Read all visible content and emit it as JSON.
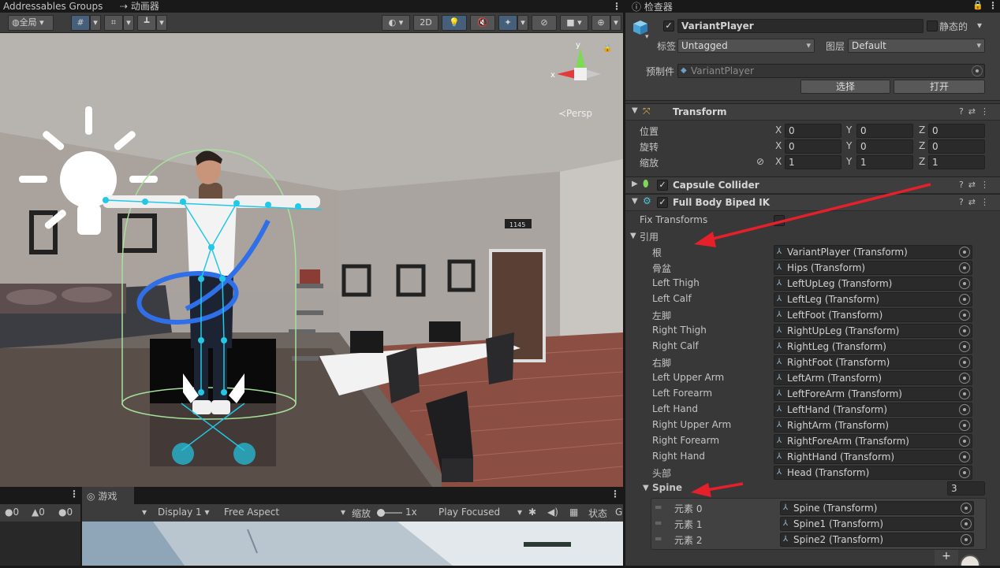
{
  "tabs": {
    "addressables": "Addressables Groups",
    "animator": "动画器",
    "inspector": "检查器"
  },
  "scene_toolbar": {
    "global": "全局",
    "mode_2d": "2D",
    "persp": "≺Persp"
  },
  "scene": {
    "wall_sign": "1145"
  },
  "bottom": {
    "counter_errors": "0",
    "counter_warnings": "0",
    "counter_messages": "0",
    "game_tab": "游戏",
    "display": "Display 1",
    "aspect": "Free Aspect",
    "scale_label": "缩放",
    "scale_value": "1x",
    "play_mode": "Play Focused",
    "stats": "状态",
    "gizmos": "Gi"
  },
  "object": {
    "name": "VariantPlayer",
    "static_label": "静态的",
    "tag_label": "标签",
    "tag_value": "Untagged",
    "layer_label": "图层",
    "layer_value": "Default",
    "prefab_label": "预制件",
    "prefab_value": "VariantPlayer",
    "select_btn": "选择",
    "open_btn": "打开"
  },
  "transform": {
    "title": "Transform",
    "position_label": "位置",
    "rotation_label": "旋转",
    "scale_label": "缩放",
    "axis_x": "X",
    "axis_y": "Y",
    "axis_z": "Z",
    "position": [
      "0",
      "0",
      "0"
    ],
    "rotation": [
      "0",
      "0",
      "0"
    ],
    "scale": [
      "1",
      "1",
      "1"
    ]
  },
  "capsule": {
    "title": "Capsule Collider"
  },
  "ik": {
    "title": "Full Body Biped IK",
    "fix_transforms": "Fix Transforms",
    "references": "引用",
    "refs": [
      {
        "label": "根",
        "value": "VariantPlayer (Transform)"
      },
      {
        "label": "骨盆",
        "value": "Hips (Transform)"
      },
      {
        "label": "Left Thigh",
        "value": "LeftUpLeg (Transform)"
      },
      {
        "label": "Left Calf",
        "value": "LeftLeg (Transform)"
      },
      {
        "label": "左脚",
        "value": "LeftFoot (Transform)"
      },
      {
        "label": "Right Thigh",
        "value": "RightUpLeg (Transform)"
      },
      {
        "label": "Right Calf",
        "value": "RightLeg (Transform)"
      },
      {
        "label": "右脚",
        "value": "RightFoot (Transform)"
      },
      {
        "label": "Left Upper Arm",
        "value": "LeftArm (Transform)"
      },
      {
        "label": "Left Forearm",
        "value": "LeftForeArm (Transform)"
      },
      {
        "label": "Left Hand",
        "value": "LeftHand (Transform)"
      },
      {
        "label": "Right Upper Arm",
        "value": "RightArm (Transform)"
      },
      {
        "label": "Right Forearm",
        "value": "RightForeArm (Transform)"
      },
      {
        "label": "Right Hand",
        "value": "RightHand (Transform)"
      },
      {
        "label": "头部",
        "value": "Head (Transform)"
      }
    ],
    "spine_label": "Spine",
    "spine_count": "3",
    "spine": [
      {
        "label": "元素 0",
        "value": "Spine (Transform)"
      },
      {
        "label": "元素 1",
        "value": "Spine1 (Transform)"
      },
      {
        "label": "元素 2",
        "value": "Spine2 (Transform)"
      }
    ],
    "add_label": "+"
  },
  "colors": {
    "accent_selection": "#46607c",
    "annotation_arrow": "#e5202a",
    "gizmo_cyan": "#22c8e6",
    "gizmo_blue": "#2f6fe8"
  }
}
